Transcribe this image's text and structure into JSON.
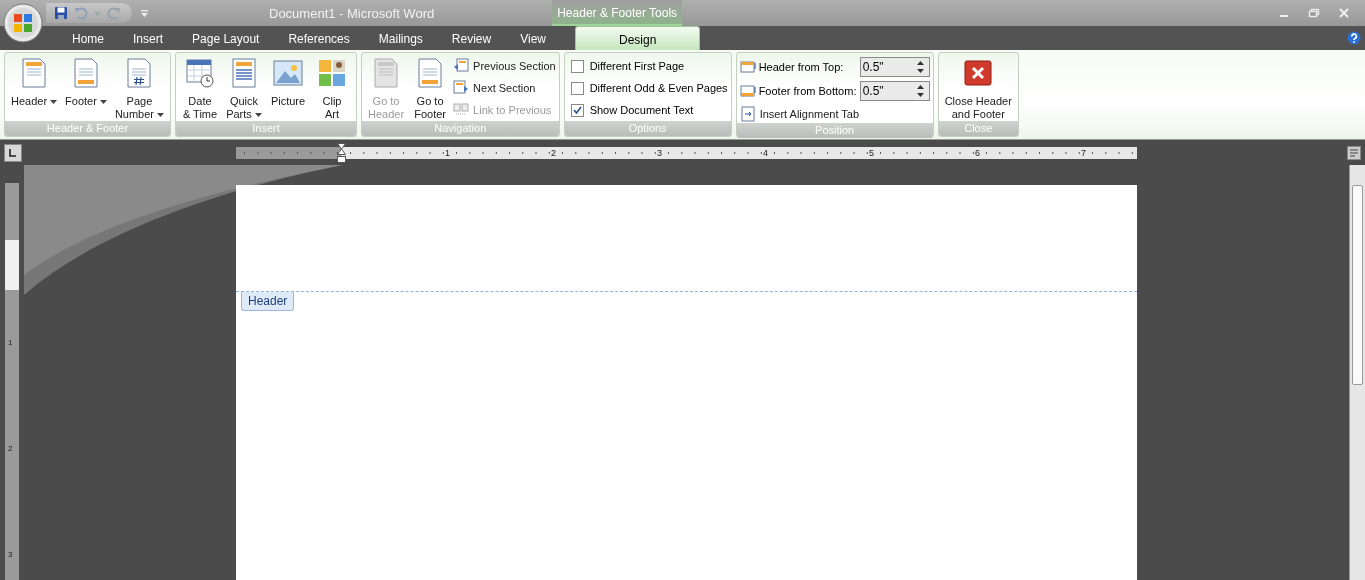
{
  "window": {
    "title": "Document1 - Microsoft Word",
    "contextual_label": "Header & Footer Tools"
  },
  "tabs": [
    {
      "label": "Home",
      "selected": false
    },
    {
      "label": "Insert",
      "selected": false
    },
    {
      "label": "Page Layout",
      "selected": false
    },
    {
      "label": "References",
      "selected": false
    },
    {
      "label": "Mailings",
      "selected": false
    },
    {
      "label": "Review",
      "selected": false
    },
    {
      "label": "View",
      "selected": false
    },
    {
      "label": "Design",
      "selected": true,
      "kind": "contextual"
    }
  ],
  "ribbon": {
    "groups": [
      {
        "label": "Header & Footer",
        "controls": [
          {
            "kind": "large",
            "lines": [
              "Header"
            ],
            "dropdown": true,
            "disabled": false
          },
          {
            "kind": "large",
            "lines": [
              "Footer"
            ],
            "dropdown": true,
            "disabled": false
          },
          {
            "kind": "large",
            "lines": [
              "Page",
              "Number"
            ],
            "dropdown": true,
            "disabled": false
          }
        ]
      },
      {
        "label": "Insert",
        "controls": [
          {
            "kind": "large",
            "lines": [
              "Date",
              "& Time"
            ],
            "dropdown": false,
            "disabled": false
          },
          {
            "kind": "large",
            "lines": [
              "Quick",
              "Parts"
            ],
            "dropdown": true,
            "disabled": false
          },
          {
            "kind": "large",
            "lines": [
              "Picture"
            ],
            "dropdown": false,
            "disabled": false
          },
          {
            "kind": "large",
            "lines": [
              "Clip",
              "Art"
            ],
            "dropdown": false,
            "disabled": false
          }
        ]
      },
      {
        "label": "Navigation",
        "controls": [
          {
            "kind": "large",
            "lines": [
              "Go to",
              "Header"
            ],
            "dropdown": false,
            "disabled": true
          },
          {
            "kind": "large",
            "lines": [
              "Go to",
              "Footer"
            ],
            "dropdown": false,
            "disabled": false
          },
          {
            "kind": "small",
            "label": "Previous Section",
            "disabled": false
          },
          {
            "kind": "small",
            "label": "Next Section",
            "disabled": false
          },
          {
            "kind": "small",
            "label": "Link to Previous",
            "disabled": true
          }
        ]
      },
      {
        "label": "Options",
        "controls": [
          {
            "kind": "checkbox",
            "label": "Different First Page",
            "checked": false
          },
          {
            "kind": "checkbox",
            "label": "Different Odd & Even Pages",
            "checked": false
          },
          {
            "kind": "checkbox",
            "label": "Show Document Text",
            "checked": true
          }
        ]
      },
      {
        "label": "Position",
        "controls": [
          {
            "kind": "spinner",
            "label": "Header from Top:",
            "value": "0.5\""
          },
          {
            "kind": "spinner",
            "label": "Footer from Bottom:",
            "value": "0.5\""
          },
          {
            "kind": "small",
            "label": "Insert Alignment Tab",
            "disabled": false
          }
        ]
      },
      {
        "label": "Close",
        "controls": [
          {
            "kind": "large",
            "lines": [
              "Close Header",
              "and Footer"
            ],
            "dropdown": false,
            "disabled": false
          }
        ]
      }
    ]
  },
  "ruler": {
    "numbers": [
      "1",
      "2",
      "3",
      "4",
      "5",
      "6",
      "7"
    ]
  },
  "vertical_ruler": {
    "numbers": [
      "1",
      "2",
      "3"
    ]
  },
  "document": {
    "header_tag": "Header"
  }
}
